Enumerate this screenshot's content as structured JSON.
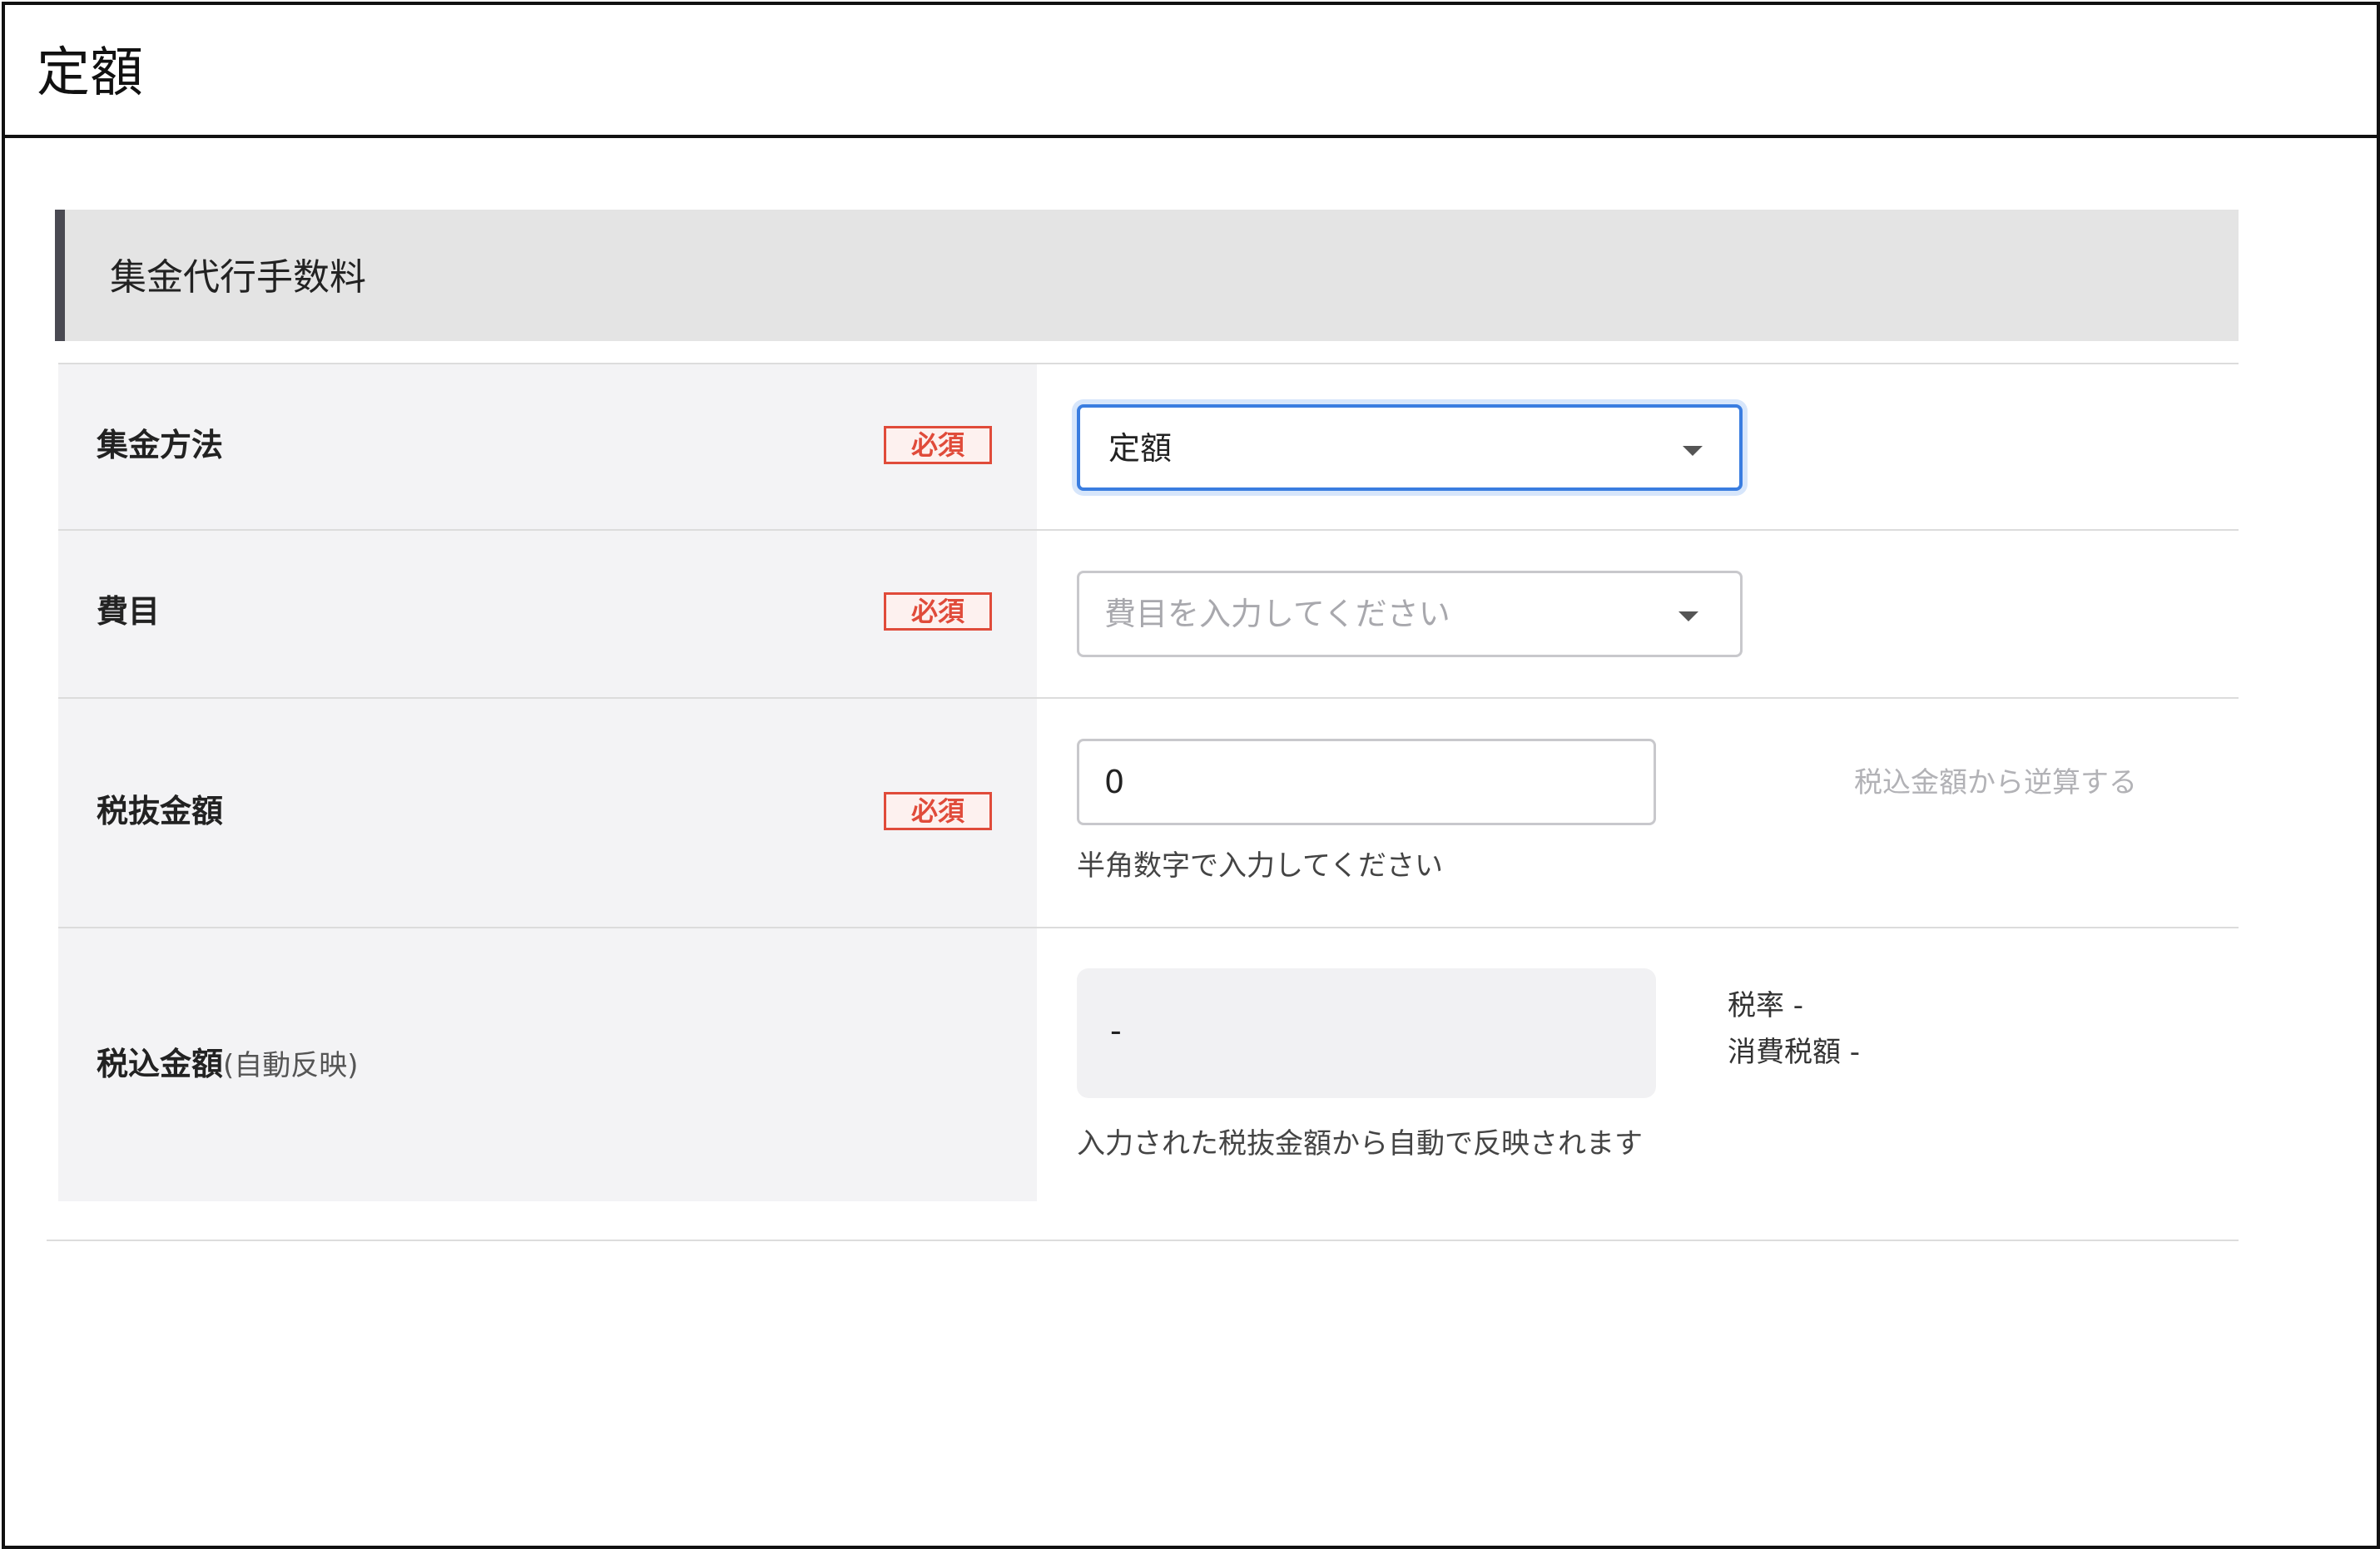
{
  "frame": {
    "title": "定額"
  },
  "section": {
    "title": "集金代行手数料"
  },
  "form": {
    "required_label": "必須",
    "collection_method": {
      "label": "集金方法",
      "value": "定額"
    },
    "expense_item": {
      "label": "費目",
      "placeholder": "費目を入力してください"
    },
    "amount_excl_tax": {
      "label": "税抜金額",
      "value": "0",
      "helper": "半角数字で入力してください",
      "reverse_calc_link": "税込金額から逆算する"
    },
    "amount_incl_tax": {
      "label": "税込金額",
      "label_suffix": "(自動反映)",
      "value": "-",
      "tax_rate": "税率 -",
      "tax_amount": "消費税額 -",
      "helper": "入力された税抜金額から自動で反映されます"
    }
  },
  "colors": {
    "accent_focus": "#3a7de0",
    "required": "#e04b3a",
    "section_bar": "#4a4a52",
    "label_bg": "#f3f3f5"
  },
  "icons": {
    "dropdown": "chevron-down-icon"
  }
}
